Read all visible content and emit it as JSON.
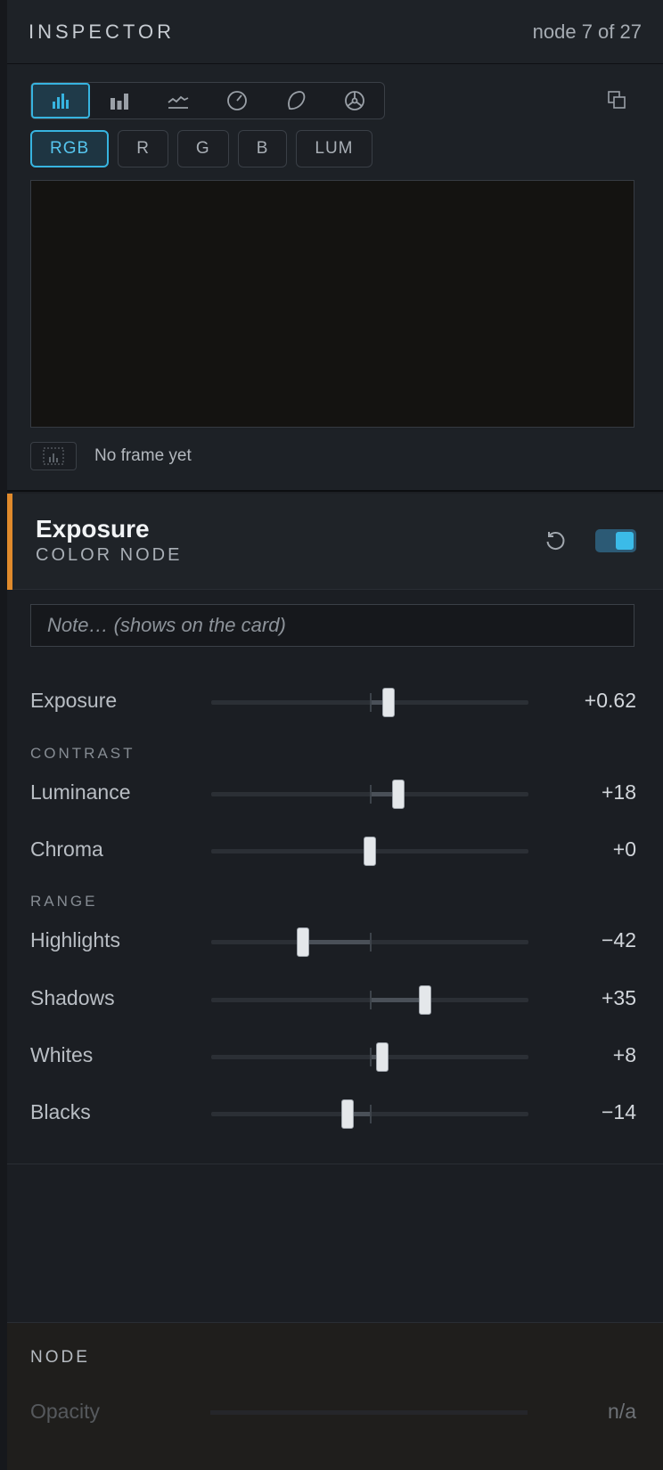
{
  "header": {
    "title": "INSPECTOR",
    "counter": "node 7 of 27"
  },
  "scope": {
    "modes": [
      "histogram-icon",
      "parade-icon",
      "waveform-icon",
      "gauge-icon",
      "hue-icon",
      "vectorscope-icon"
    ],
    "active_mode": "histogram-icon",
    "channels": [
      "RGB",
      "R",
      "G",
      "B",
      "LUM"
    ],
    "active_channel": "RGB",
    "empty_text": "No frame yet"
  },
  "node": {
    "title": "Exposure",
    "subtitle": "COLOR NODE",
    "enabled": true,
    "note_placeholder": "Note… (shows on the card)",
    "accent_color": "#e08a2c"
  },
  "sliders": {
    "exposure": {
      "label": "Exposure",
      "value": "+0.62",
      "level": 0.56
    },
    "contrast_header": "CONTRAST",
    "luminance": {
      "label": "Luminance",
      "value": "+18",
      "level": 0.59
    },
    "chroma": {
      "label": "Chroma",
      "value": "+0",
      "level": 0.5
    },
    "range_header": "RANGE",
    "highlights": {
      "label": "Highlights",
      "value": "−42",
      "level": 0.29
    },
    "shadows": {
      "label": "Shadows",
      "value": "+35",
      "level": 0.675
    },
    "whites": {
      "label": "Whites",
      "value": "+8",
      "level": 0.54
    },
    "blacks": {
      "label": "Blacks",
      "value": "−14",
      "level": 0.43
    }
  },
  "node_section": {
    "header": "NODE",
    "opacity_label": "Opacity",
    "opacity_value": "n/a"
  },
  "colors": {
    "accent_blue": "#37b4e0",
    "accent_orange": "#e08a2c"
  }
}
